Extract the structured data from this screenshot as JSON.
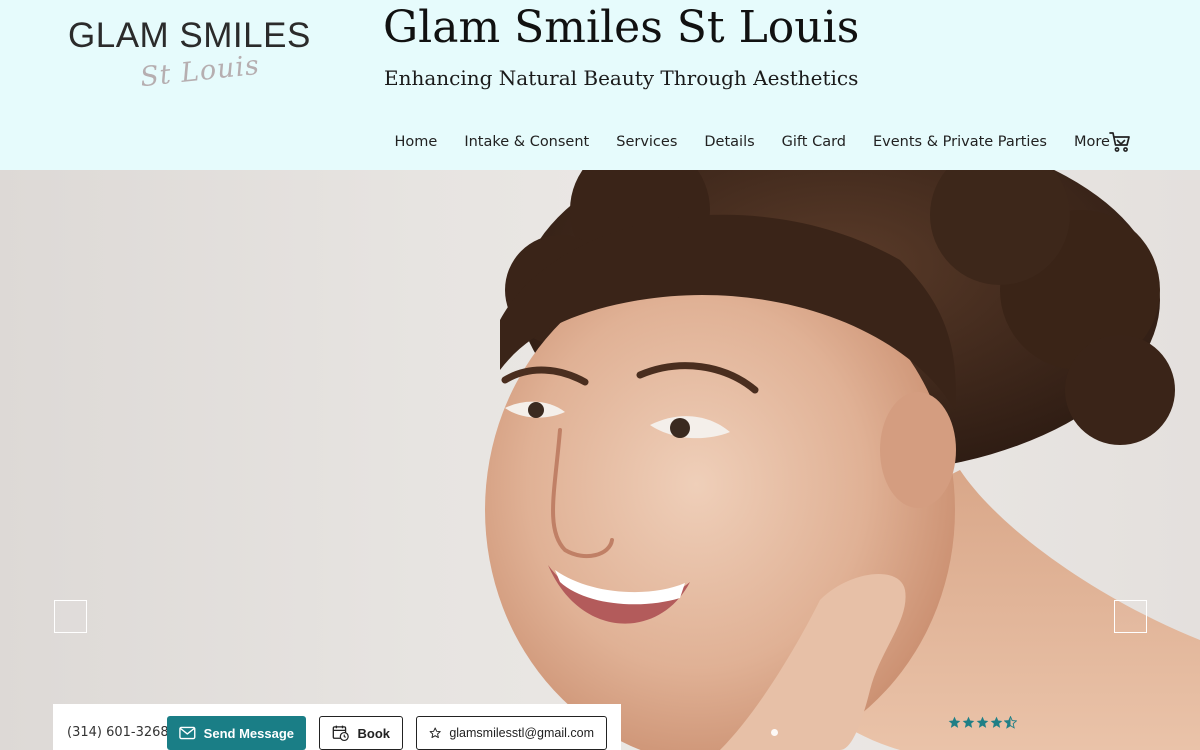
{
  "logo": {
    "main": "GLAM SMILES",
    "script": "St Louis"
  },
  "site": {
    "title": "Glam Smiles St Louis",
    "tagline": "Enhancing Natural Beauty Through Aesthetics"
  },
  "nav": {
    "items": [
      "Home",
      "Intake & Consent",
      "Services",
      "Details",
      "Gift Card",
      "Events & Private Parties"
    ],
    "more_label": "More"
  },
  "contact": {
    "phone": "(314) 601-3268",
    "send_label": "Send Message",
    "book_label": "Book",
    "email": "glamsmilesstl@gmail.com"
  },
  "rating": {
    "stars": 4.5,
    "max": 5
  },
  "colors": {
    "header_bg": "#e6fbfc",
    "accent": "#1a7e86",
    "star": "#1f7f86"
  },
  "icons": {
    "cart": "shopping-cart-icon",
    "send": "envelope-icon",
    "book": "calendar-clock-icon",
    "email": "star-outline-icon",
    "more": "chevron-down-icon"
  }
}
